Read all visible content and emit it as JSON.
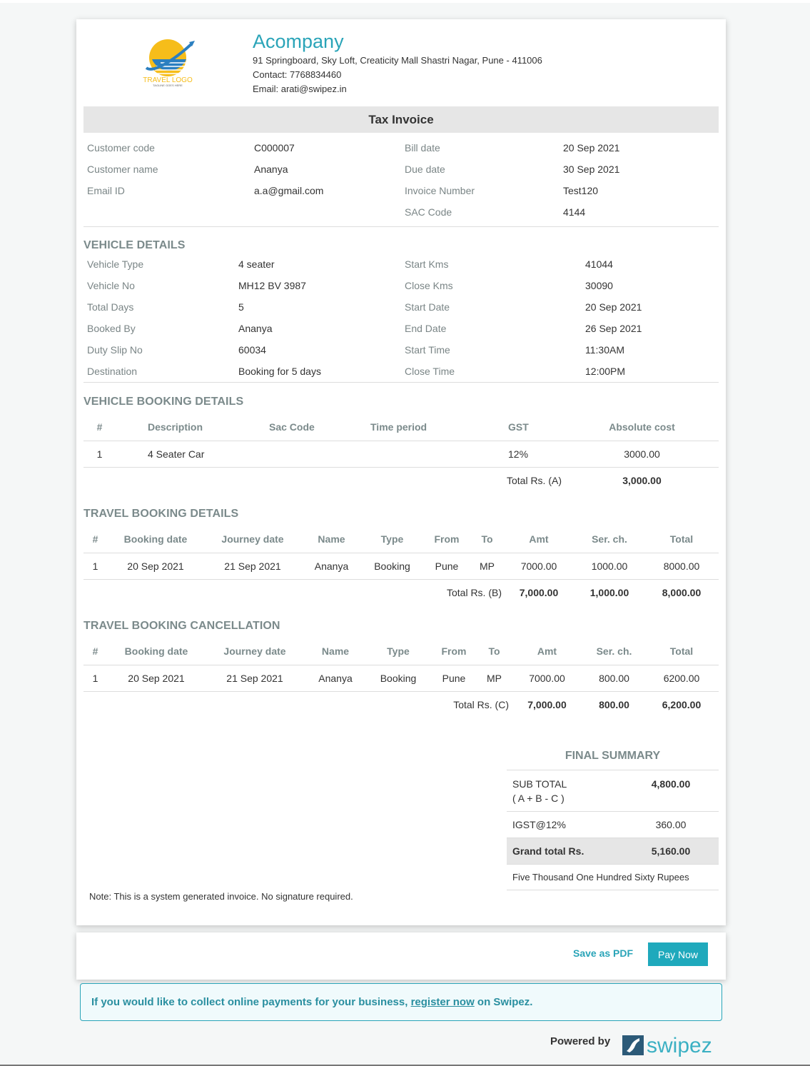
{
  "company": {
    "name": "Acompany",
    "address": "91 Springboard, Sky Loft, Creaticity Mall Shastri Nagar, Pune - 411006",
    "contact": "Contact: 7768834460",
    "email": "Email: arati@swipez.in",
    "logo_text": "TRAVEL LOGO",
    "logo_tagline": "TAGLINE GOES HERE"
  },
  "invoice_title": "Tax Invoice",
  "customer_info": {
    "left": [
      {
        "label": "Customer code",
        "value": "C000007"
      },
      {
        "label": "Customer name",
        "value": "Ananya"
      },
      {
        "label": "Email ID",
        "value": "a.a@gmail.com"
      }
    ],
    "right": [
      {
        "label": "Bill date",
        "value": "20 Sep 2021"
      },
      {
        "label": "Due date",
        "value": "30 Sep 2021"
      },
      {
        "label": "Invoice Number",
        "value": "Test120"
      },
      {
        "label": "SAC Code",
        "value": "4144"
      }
    ]
  },
  "vehicle_details": {
    "title": "VEHICLE DETAILS",
    "left": [
      {
        "label": "Vehicle Type",
        "value": "4 seater"
      },
      {
        "label": "Vehicle No",
        "value": "MH12 BV 3987"
      },
      {
        "label": "Total Days",
        "value": "5"
      },
      {
        "label": "Booked By",
        "value": "Ananya"
      },
      {
        "label": "Duty Slip No",
        "value": "60034"
      },
      {
        "label": "Destination",
        "value": "Booking for 5 days"
      }
    ],
    "right": [
      {
        "label": "Start Kms",
        "value": "41044"
      },
      {
        "label": "Close Kms",
        "value": "30090"
      },
      {
        "label": "Start Date",
        "value": "20 Sep 2021"
      },
      {
        "label": "End Date",
        "value": "26 Sep 2021"
      },
      {
        "label": "Start Time",
        "value": "11:30AM"
      },
      {
        "label": "Close Time",
        "value": "12:00PM"
      }
    ]
  },
  "vehicle_booking": {
    "title": "VEHICLE BOOKING DETAILS",
    "headers": [
      "#",
      "Description",
      "Sac Code",
      "Time period",
      "GST",
      "Absolute cost"
    ],
    "rows": [
      [
        "1",
        "4 Seater Car",
        "",
        "",
        "12%",
        "3000.00"
      ]
    ],
    "total_label": "Total Rs. (A)",
    "total_value": "3,000.00"
  },
  "travel_booking": {
    "title": "TRAVEL BOOKING DETAILS",
    "headers": [
      "#",
      "Booking date",
      "Journey date",
      "Name",
      "Type",
      "From",
      "To",
      "Amt",
      "Ser. ch.",
      "Total"
    ],
    "rows": [
      [
        "1",
        "20 Sep 2021",
        "21 Sep 2021",
        "Ananya",
        "Booking",
        "Pune",
        "MP",
        "7000.00",
        "1000.00",
        "8000.00"
      ]
    ],
    "total_label": "Total Rs. (B)",
    "total_amt": "7,000.00",
    "total_ser": "1,000.00",
    "total_total": "8,000.00"
  },
  "travel_cancellation": {
    "title": "TRAVEL BOOKING CANCELLATION",
    "headers": [
      "#",
      "Booking date",
      "Journey date",
      "Name",
      "Type",
      "From",
      "To",
      "Amt",
      "Ser. ch.",
      "Total"
    ],
    "rows": [
      [
        "1",
        "20 Sep 2021",
        "21 Sep 2021",
        "Ananya",
        "Booking",
        "Pune",
        "MP",
        "7000.00",
        "800.00",
        "6200.00"
      ]
    ],
    "total_label": "Total Rs. (C)",
    "total_amt": "7,000.00",
    "total_ser": "800.00",
    "total_total": "6,200.00"
  },
  "final_summary": {
    "title": "FINAL SUMMARY",
    "subtotal_label": "SUB TOTAL",
    "subtotal_formula": "( A + B - C )",
    "subtotal_value": "4,800.00",
    "tax_label": "IGST@12%",
    "tax_value": "360.00",
    "grand_label": "Grand total Rs.",
    "grand_value": "5,160.00",
    "amount_words": "Five Thousand One Hundred Sixty Rupees"
  },
  "note": "Note: This is a system generated invoice. No signature required.",
  "actions": {
    "save_pdf": "Save as PDF",
    "pay_now": "Pay Now"
  },
  "promo": {
    "before": "If you would like to collect online payments for your business, ",
    "link": "register now",
    "after": " on Swipez."
  },
  "footer": {
    "powered_by": "Powered by",
    "brand": "swipez"
  },
  "colors": {
    "accent": "#2aa4b8",
    "button": "#1fa9bc",
    "section_title": "#7b8a8b",
    "title_bar": "#e6e6e6"
  }
}
